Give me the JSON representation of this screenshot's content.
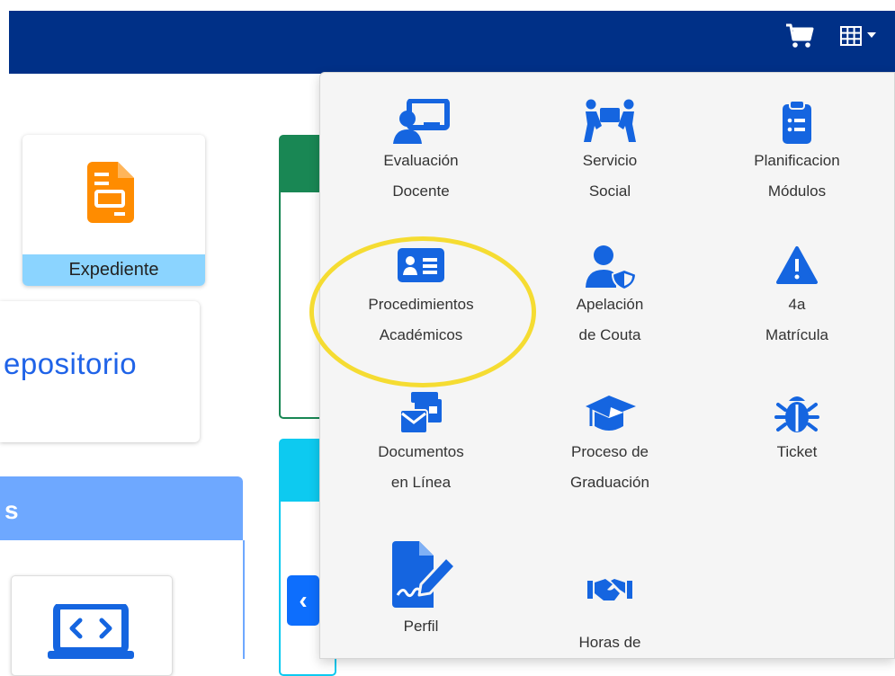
{
  "colors": {
    "navbar": "#003087",
    "menu_bg": "#f5f5f5",
    "icon_blue": "#1565e0",
    "expediente_orange": "#ff8c00",
    "expediente_label_bg": "#8bd4ff",
    "repositorio_text": "#1f63e8",
    "green_header": "#198754",
    "cyan_header": "#0dcaf0",
    "blue_header": "#6ea8ff",
    "highlight_ring": "#f5dc32"
  },
  "navbar": {
    "icons": [
      "cart-icon",
      "apps-grid-icon",
      "caret-down-icon"
    ]
  },
  "dashboard": {
    "expediente_label": "Expediente",
    "repositorio_label": "epositorio",
    "section_label": "s",
    "prev_arrow": "‹"
  },
  "menu": {
    "items": [
      {
        "line1": "Evaluación",
        "line2": "Docente",
        "icon": "teacher-board-icon"
      },
      {
        "line1": "Servicio",
        "line2": "Social",
        "icon": "people-carry-icon"
      },
      {
        "line1": "Planificacion",
        "line2": "Módulos",
        "icon": "clipboard-list-icon"
      },
      {
        "line1": "Procedimientos",
        "line2": "Académicos",
        "icon": "id-card-icon"
      },
      {
        "line1": "Apelación",
        "line2": "de Couta",
        "icon": "user-shield-icon"
      },
      {
        "line1": "4a",
        "line2": "Matrícula",
        "icon": "warning-triangle-icon"
      },
      {
        "line1": "Documentos",
        "line2": "en Línea",
        "icon": "envelope-documents-icon"
      },
      {
        "line1": "Proceso de",
        "line2": "Graduación",
        "icon": "graduation-cap-icon"
      },
      {
        "line1": "Ticket",
        "line2": "",
        "icon": "bug-icon"
      },
      {
        "line1": "Perfil",
        "line2": "",
        "icon": "signature-icon"
      },
      {
        "line1": "Horas de",
        "line2": "",
        "icon": "handshake-icon"
      }
    ]
  }
}
